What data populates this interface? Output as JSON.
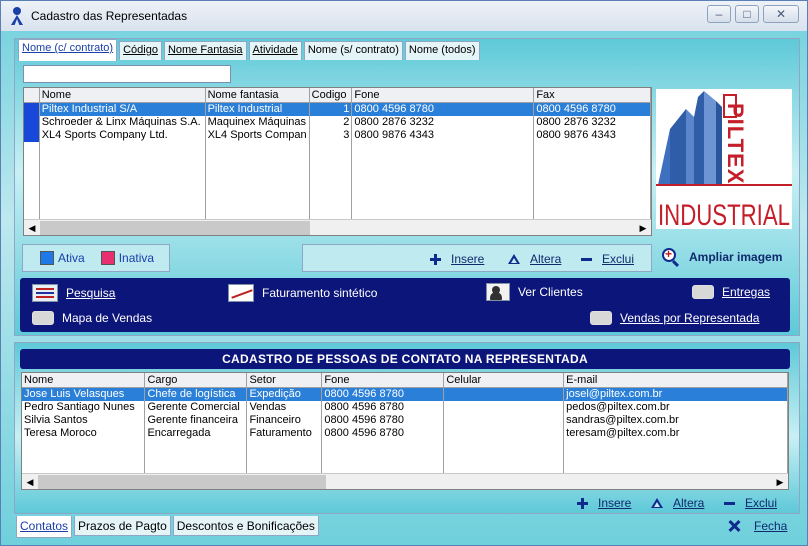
{
  "window": {
    "title": "Cadastro das Representadas",
    "minimize": "–",
    "maximize": "□",
    "close": "✕"
  },
  "tabs": [
    {
      "label": "Nome (c/ contrato)",
      "active": true
    },
    {
      "label": "Código"
    },
    {
      "label": "Nome Fantasia"
    },
    {
      "label": "Atividade"
    },
    {
      "label": "Nome (s/ contrato)"
    },
    {
      "label": "Nome (todos)"
    }
  ],
  "search": {
    "value": ""
  },
  "companies": {
    "columns": [
      "Nome",
      "Nome fantasia",
      "Codigo",
      "Fone",
      "Fax"
    ],
    "rows": [
      {
        "nome": "Piltex Industrial S/A",
        "fantasia": "Piltex Industrial",
        "codigo": "1",
        "fone": "0800 4596 8780",
        "fax": "0800 4596 8780",
        "selected": true
      },
      {
        "nome": "Schroeder & Linx Máquinas S.A.",
        "fantasia": "Maquinex Máquinas",
        "codigo": "2",
        "fone": "0800 2876 3232",
        "fax": "0800 2876 3232"
      },
      {
        "nome": "XL4 Sports Company Ltd.",
        "fantasia": "XL4 Sports Compan",
        "codigo": "3",
        "fone": "0800 9876 4343",
        "fax": "0800 9876 4343"
      }
    ]
  },
  "logo": {
    "line1": "PILTEX",
    "line2": "INDUSTRIAL",
    "color": "#c41e2a",
    "building_color": "#2f5da8"
  },
  "legend": {
    "ativa": {
      "label": "Ativa",
      "color": "#1e78e8"
    },
    "inativa": {
      "label": "Inativa",
      "color": "#e83070"
    }
  },
  "actions": {
    "insere": "Insere",
    "altera": "Altera",
    "exclui": "Exclui"
  },
  "zoom_label": "Ampliar imagem",
  "nav": {
    "pesquisa": "Pesquisa",
    "faturamento": "Faturamento sintético",
    "clientes": "Ver Clientes",
    "entregas": "Entregas",
    "mapa": "Mapa de Vendas",
    "vendas": "Vendas por Representada"
  },
  "contacts": {
    "header": "CADASTRO DE PESSOAS DE CONTATO NA REPRESENTADA",
    "columns": [
      "Nome",
      "Cargo",
      "Setor",
      "Fone",
      "Celular",
      "E-mail"
    ],
    "rows": [
      {
        "nome": "Jose Luis Velasques",
        "cargo": "Chefe de logística",
        "setor": "Expedição",
        "fone": "0800 4596 8780",
        "celular": "",
        "email": "josel@piltex.com.br",
        "selected": true
      },
      {
        "nome": "Pedro Santiago Nunes",
        "cargo": "Gerente Comercial",
        "setor": "Vendas",
        "fone": "0800 4596 8780",
        "celular": "",
        "email": "pedos@piltex.com.br"
      },
      {
        "nome": "Silvia Santos",
        "cargo": "Gerente financeira",
        "setor": "Financeiro",
        "fone": "0800 4596 8780",
        "celular": "",
        "email": "sandras@piltex.com.br"
      },
      {
        "nome": "Teresa Moroco",
        "cargo": "Encarregada",
        "setor": "Faturamento",
        "fone": "0800 4596 8780",
        "celular": "",
        "email": "teresam@piltex.com.br"
      }
    ]
  },
  "bottom_tabs": [
    {
      "label": "Contatos",
      "active": true
    },
    {
      "label": "Prazos de Pagto"
    },
    {
      "label": "Descontos e Bonificações"
    }
  ],
  "close_label": "Fecha"
}
